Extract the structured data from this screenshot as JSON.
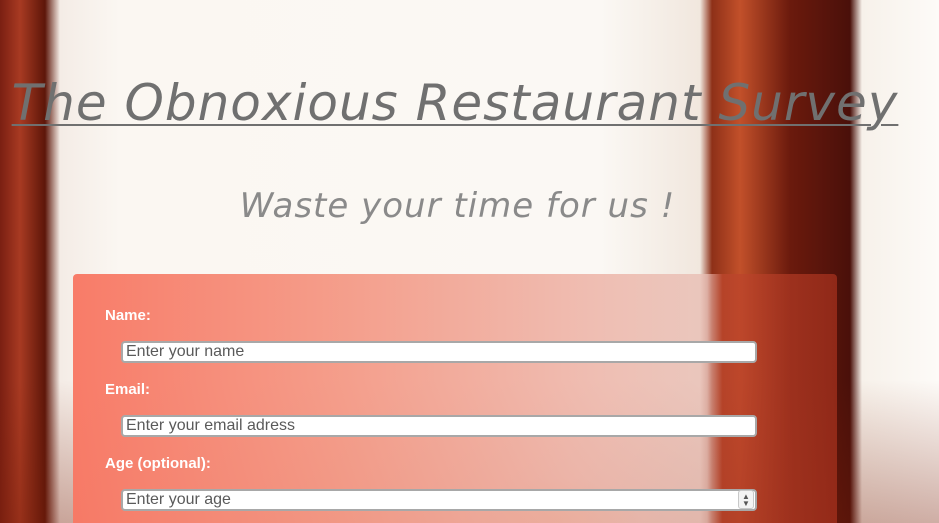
{
  "header": {
    "title": "The Obnoxious Restaurant Survey",
    "subtitle": "Waste your time for us !"
  },
  "form": {
    "name": {
      "label": "Name:",
      "placeholder": "Enter your name"
    },
    "email": {
      "label": "Email:",
      "placeholder": "Enter your email adress"
    },
    "age": {
      "label": "Age (optional):",
      "placeholder": "Enter your age"
    }
  },
  "icons": {
    "age_stepper": "number-stepper-icon"
  }
}
